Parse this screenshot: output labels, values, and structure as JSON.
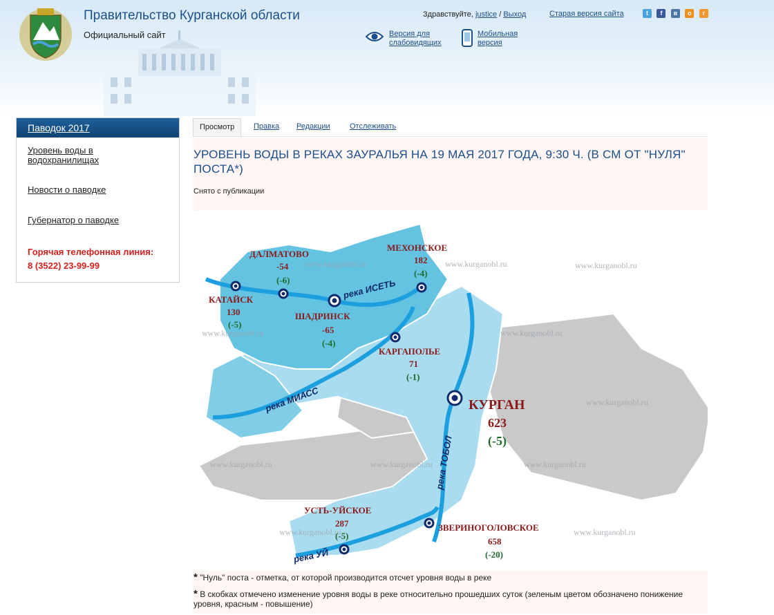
{
  "header": {
    "title": "Правительство Курганской области",
    "subtitle": "Официальный сайт",
    "greeting": "Здравствуйте,",
    "username": "justice",
    "separator": "/",
    "logout": "Выход",
    "old_version": "Старая версия сайта",
    "accessibility_label": "Версия для слабовидящих",
    "mobile_label": "Мобильная версия",
    "social_icons": [
      "twitter-icon",
      "facebook-icon",
      "vk-icon",
      "odnoklassniki-icon",
      "rss-icon"
    ]
  },
  "sidebar": {
    "heading": "Паводок 2017",
    "items": [
      {
        "label": "Уровень воды в водохранилищах"
      },
      {
        "label": "Новости о паводке"
      },
      {
        "label": "Губернатор о паводке"
      }
    ],
    "hotline_title": "Горячая телефонная линия:",
    "hotline_phone": "8 (3522) 23-99-99"
  },
  "tabs": [
    {
      "label": "Просмотр",
      "active": true
    },
    {
      "label": "Правка",
      "active": false
    },
    {
      "label": "Редакции",
      "active": false
    },
    {
      "label": "Отслеживать",
      "active": false
    }
  ],
  "page": {
    "title": "УРОВЕНЬ ВОДЫ В РЕКАХ ЗАУРАЛЬЯ НА 19 МАЯ 2017 ГОДА, 9:30 Ч. (В СМ ОТ \"НУЛЯ\" ПОСТА*)",
    "status": "Снято с публикации"
  },
  "map_labels": {
    "watermark": "www.kurganobl.ru",
    "stations": [
      {
        "name": "ДАЛМАТОВО",
        "level": "-54",
        "change": "(-6)"
      },
      {
        "name": "МЕХОНСКОЕ",
        "level": "182",
        "change": "(-4)"
      },
      {
        "name": "КАТАЙСК",
        "level": "130",
        "change": "(-5)"
      },
      {
        "name": "ШАДРИНСК",
        "level": "-65",
        "change": "(-4)"
      },
      {
        "name": "КАРГАПОЛЬЕ",
        "level": "71",
        "change": "(-1)"
      },
      {
        "name": "КУРГАН",
        "level": "623",
        "change": "(-5)"
      },
      {
        "name": "УСТЬ-УЙСКОЕ",
        "level": "287",
        "change": "(-5)"
      },
      {
        "name": "ЗВЕРИНОГОЛОВСКОЕ",
        "level": "658",
        "change": "(-20)"
      }
    ],
    "rivers": [
      "река ИСЕТЬ",
      "река МИАСС",
      "река ТОБОЛ",
      "река УЙ"
    ]
  },
  "footnotes": [
    {
      "mark": "*",
      "text": "\"Нуль\" поста - отметка, от которой производится отсчет уровня воды в реке"
    },
    {
      "mark": "*",
      "text": "В скобках отмечено изменение уровня воды в реке относительно прошедших суток (зеленым цветом обозначено понижение уровня, красным - повышение)"
    }
  ],
  "colors": {
    "brand_blue": "#1a4f8a",
    "hotline_red": "#d4201b",
    "level_red": "#8b1a1a",
    "change_green": "#1e6b2a",
    "region_blue": "#64c3e0",
    "region_light": "#a9dcef",
    "region_gray": "#c9c9c9"
  }
}
